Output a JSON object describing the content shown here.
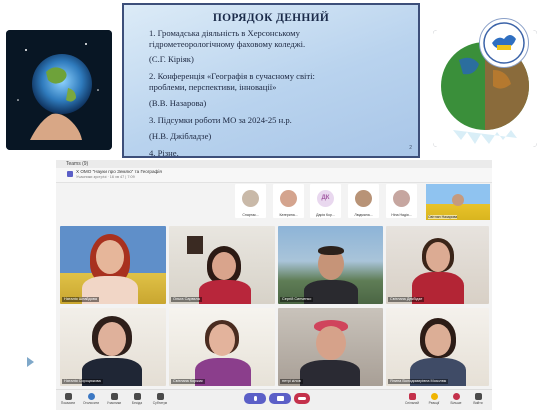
{
  "slide": {
    "title": "ПОРЯДОК ДЕННИЙ",
    "lines": [
      "1. Громадська діяльність в Херсонському",
      "гідрометеорологічному фаховому коледжі.",
      "(С.Г. Кіріяк)",
      "2. Конференція «Географія в сучасному світі:",
      "проблеми, перспективи, інновації»",
      "(В.В. Назарова)",
      "3. Підсумки роботи МО за 2024-25 н.р.",
      "(Н.В. Джібладзе)",
      "4. Різне."
    ],
    "page": "2"
  },
  "teams": {
    "app_title": "Teams (9)",
    "meeting_title": "Х ОМО \"Науки про Землю\" та Географія",
    "meeting_sub": "Учасники зустрічі · 16 хв 47 | 7:09",
    "participants_strip": [
      {
        "name": "Спартак..."
      },
      {
        "name": "Катерина..."
      },
      {
        "name": "Дарія Кор...",
        "initials": "ДК"
      },
      {
        "name": "Людмила..."
      },
      {
        "name": "Ніна Надія..."
      },
      {
        "name": "Ірина Л..."
      },
      {
        "name": "Світлан Назарова"
      }
    ],
    "tiles": [
      {
        "name": "Наталія Шнайдова"
      },
      {
        "name": "Ольга Сарвєла"
      },
      {
        "name": "Сергій Синченко"
      },
      {
        "name": "Світлана Декбідзе"
      },
      {
        "name": "Наталія Сороцюкова"
      },
      {
        "name": "Світлана Коржик"
      },
      {
        "name": "нетрі кілов"
      },
      {
        "name": "Ялина Володимирівна Мозолюк"
      }
    ],
    "controls": [
      {
        "label": "Показати",
        "icon": "share-screen-icon"
      },
      {
        "label": "Оголосити",
        "icon": "announce-icon"
      },
      {
        "label": "Учасники",
        "icon": "people-icon"
      },
      {
        "label": "Бесіда",
        "icon": "chat-icon"
      },
      {
        "label": "Субтитри",
        "icon": "captions-icon"
      },
      {
        "label": "Спільний",
        "icon": "share-icon"
      },
      {
        "label": "Реакції",
        "icon": "reactions-icon"
      },
      {
        "label": "Більше",
        "icon": "more-icon"
      },
      {
        "label": "Вийти",
        "icon": "leave-icon"
      }
    ]
  }
}
